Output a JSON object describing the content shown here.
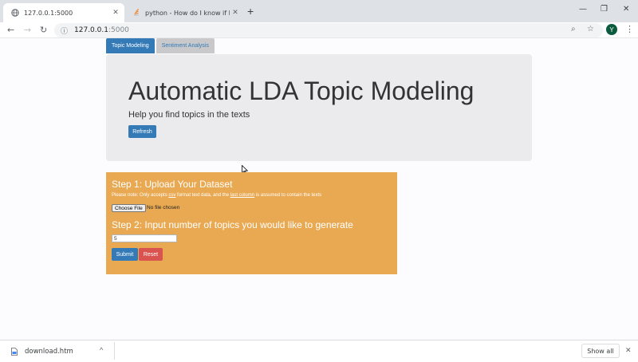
{
  "browser": {
    "tabs": [
      {
        "title": "127.0.0.1:5000",
        "favicon": "globe-icon",
        "active": true
      },
      {
        "title": "python - How do I know if I can d",
        "favicon": "stackoverflow-icon",
        "active": false
      }
    ],
    "new_tab_glyph": "+",
    "window_controls": {
      "minimize": "—",
      "restore": "❐",
      "close": "✕"
    },
    "address": {
      "host": "127.0.0.1",
      "port": ":5000"
    },
    "avatar_letter": "Y",
    "nav": {
      "back": "←",
      "forward": "→",
      "reload": "↻"
    },
    "icons": {
      "zoom": "⌕",
      "star": "☆",
      "menu": "⋮",
      "info": "ⓘ"
    }
  },
  "page": {
    "tabs": {
      "topic": "Topic Modeling",
      "sentiment": "Sentiment Analysis"
    },
    "hero": {
      "title": "Automatic LDA Topic Modeling",
      "subtitle": "Help you find topics in the texts",
      "refresh_label": "Refresh"
    },
    "form": {
      "step1_title": "Step 1: Upload Your Dataset",
      "note_prefix": "Please note: Only accepts ",
      "note_csv": "csv",
      "note_middle": " format text data, and the ",
      "note_last_column": "last column",
      "note_suffix": " is assumed to contain the texts",
      "choose_file_label": "Choose File",
      "file_status": "No file chosen",
      "step2_title": "Step 2: Input number of topics you would like to generate",
      "topics_value": "5",
      "submit_label": "Submit",
      "reset_label": "Reset"
    }
  },
  "downloads": {
    "file_name": "download.htm",
    "show_all_label": "Show all",
    "chevron": "^",
    "close": "✕"
  },
  "colors": {
    "primary": "#337ab7",
    "danger": "#d9534f",
    "panel": "#e9a952",
    "jumbotron": "#ebebed"
  }
}
